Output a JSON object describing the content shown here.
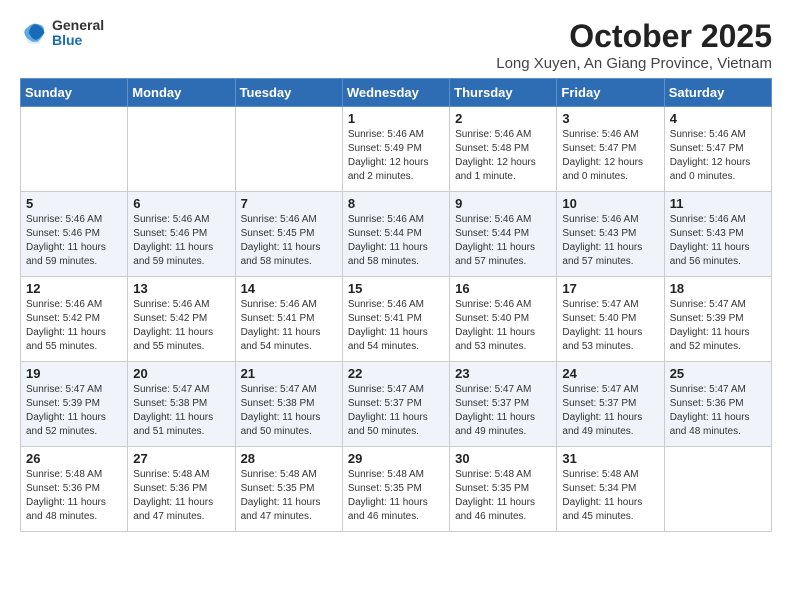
{
  "header": {
    "logo_general": "General",
    "logo_blue": "Blue",
    "month_title": "October 2025",
    "location": "Long Xuyen, An Giang Province, Vietnam"
  },
  "days_of_week": [
    "Sunday",
    "Monday",
    "Tuesday",
    "Wednesday",
    "Thursday",
    "Friday",
    "Saturday"
  ],
  "weeks": [
    [
      {
        "day": "",
        "sunrise": "",
        "sunset": "",
        "daylight": ""
      },
      {
        "day": "",
        "sunrise": "",
        "sunset": "",
        "daylight": ""
      },
      {
        "day": "",
        "sunrise": "",
        "sunset": "",
        "daylight": ""
      },
      {
        "day": "1",
        "sunrise": "Sunrise: 5:46 AM",
        "sunset": "Sunset: 5:49 PM",
        "daylight": "Daylight: 12 hours and 2 minutes."
      },
      {
        "day": "2",
        "sunrise": "Sunrise: 5:46 AM",
        "sunset": "Sunset: 5:48 PM",
        "daylight": "Daylight: 12 hours and 1 minute."
      },
      {
        "day": "3",
        "sunrise": "Sunrise: 5:46 AM",
        "sunset": "Sunset: 5:47 PM",
        "daylight": "Daylight: 12 hours and 0 minutes."
      },
      {
        "day": "4",
        "sunrise": "Sunrise: 5:46 AM",
        "sunset": "Sunset: 5:47 PM",
        "daylight": "Daylight: 12 hours and 0 minutes."
      }
    ],
    [
      {
        "day": "5",
        "sunrise": "Sunrise: 5:46 AM",
        "sunset": "Sunset: 5:46 PM",
        "daylight": "Daylight: 11 hours and 59 minutes."
      },
      {
        "day": "6",
        "sunrise": "Sunrise: 5:46 AM",
        "sunset": "Sunset: 5:46 PM",
        "daylight": "Daylight: 11 hours and 59 minutes."
      },
      {
        "day": "7",
        "sunrise": "Sunrise: 5:46 AM",
        "sunset": "Sunset: 5:45 PM",
        "daylight": "Daylight: 11 hours and 58 minutes."
      },
      {
        "day": "8",
        "sunrise": "Sunrise: 5:46 AM",
        "sunset": "Sunset: 5:44 PM",
        "daylight": "Daylight: 11 hours and 58 minutes."
      },
      {
        "day": "9",
        "sunrise": "Sunrise: 5:46 AM",
        "sunset": "Sunset: 5:44 PM",
        "daylight": "Daylight: 11 hours and 57 minutes."
      },
      {
        "day": "10",
        "sunrise": "Sunrise: 5:46 AM",
        "sunset": "Sunset: 5:43 PM",
        "daylight": "Daylight: 11 hours and 57 minutes."
      },
      {
        "day": "11",
        "sunrise": "Sunrise: 5:46 AM",
        "sunset": "Sunset: 5:43 PM",
        "daylight": "Daylight: 11 hours and 56 minutes."
      }
    ],
    [
      {
        "day": "12",
        "sunrise": "Sunrise: 5:46 AM",
        "sunset": "Sunset: 5:42 PM",
        "daylight": "Daylight: 11 hours and 55 minutes."
      },
      {
        "day": "13",
        "sunrise": "Sunrise: 5:46 AM",
        "sunset": "Sunset: 5:42 PM",
        "daylight": "Daylight: 11 hours and 55 minutes."
      },
      {
        "day": "14",
        "sunrise": "Sunrise: 5:46 AM",
        "sunset": "Sunset: 5:41 PM",
        "daylight": "Daylight: 11 hours and 54 minutes."
      },
      {
        "day": "15",
        "sunrise": "Sunrise: 5:46 AM",
        "sunset": "Sunset: 5:41 PM",
        "daylight": "Daylight: 11 hours and 54 minutes."
      },
      {
        "day": "16",
        "sunrise": "Sunrise: 5:46 AM",
        "sunset": "Sunset: 5:40 PM",
        "daylight": "Daylight: 11 hours and 53 minutes."
      },
      {
        "day": "17",
        "sunrise": "Sunrise: 5:47 AM",
        "sunset": "Sunset: 5:40 PM",
        "daylight": "Daylight: 11 hours and 53 minutes."
      },
      {
        "day": "18",
        "sunrise": "Sunrise: 5:47 AM",
        "sunset": "Sunset: 5:39 PM",
        "daylight": "Daylight: 11 hours and 52 minutes."
      }
    ],
    [
      {
        "day": "19",
        "sunrise": "Sunrise: 5:47 AM",
        "sunset": "Sunset: 5:39 PM",
        "daylight": "Daylight: 11 hours and 52 minutes."
      },
      {
        "day": "20",
        "sunrise": "Sunrise: 5:47 AM",
        "sunset": "Sunset: 5:38 PM",
        "daylight": "Daylight: 11 hours and 51 minutes."
      },
      {
        "day": "21",
        "sunrise": "Sunrise: 5:47 AM",
        "sunset": "Sunset: 5:38 PM",
        "daylight": "Daylight: 11 hours and 50 minutes."
      },
      {
        "day": "22",
        "sunrise": "Sunrise: 5:47 AM",
        "sunset": "Sunset: 5:37 PM",
        "daylight": "Daylight: 11 hours and 50 minutes."
      },
      {
        "day": "23",
        "sunrise": "Sunrise: 5:47 AM",
        "sunset": "Sunset: 5:37 PM",
        "daylight": "Daylight: 11 hours and 49 minutes."
      },
      {
        "day": "24",
        "sunrise": "Sunrise: 5:47 AM",
        "sunset": "Sunset: 5:37 PM",
        "daylight": "Daylight: 11 hours and 49 minutes."
      },
      {
        "day": "25",
        "sunrise": "Sunrise: 5:47 AM",
        "sunset": "Sunset: 5:36 PM",
        "daylight": "Daylight: 11 hours and 48 minutes."
      }
    ],
    [
      {
        "day": "26",
        "sunrise": "Sunrise: 5:48 AM",
        "sunset": "Sunset: 5:36 PM",
        "daylight": "Daylight: 11 hours and 48 minutes."
      },
      {
        "day": "27",
        "sunrise": "Sunrise: 5:48 AM",
        "sunset": "Sunset: 5:36 PM",
        "daylight": "Daylight: 11 hours and 47 minutes."
      },
      {
        "day": "28",
        "sunrise": "Sunrise: 5:48 AM",
        "sunset": "Sunset: 5:35 PM",
        "daylight": "Daylight: 11 hours and 47 minutes."
      },
      {
        "day": "29",
        "sunrise": "Sunrise: 5:48 AM",
        "sunset": "Sunset: 5:35 PM",
        "daylight": "Daylight: 11 hours and 46 minutes."
      },
      {
        "day": "30",
        "sunrise": "Sunrise: 5:48 AM",
        "sunset": "Sunset: 5:35 PM",
        "daylight": "Daylight: 11 hours and 46 minutes."
      },
      {
        "day": "31",
        "sunrise": "Sunrise: 5:48 AM",
        "sunset": "Sunset: 5:34 PM",
        "daylight": "Daylight: 11 hours and 45 minutes."
      },
      {
        "day": "",
        "sunrise": "",
        "sunset": "",
        "daylight": ""
      }
    ]
  ]
}
